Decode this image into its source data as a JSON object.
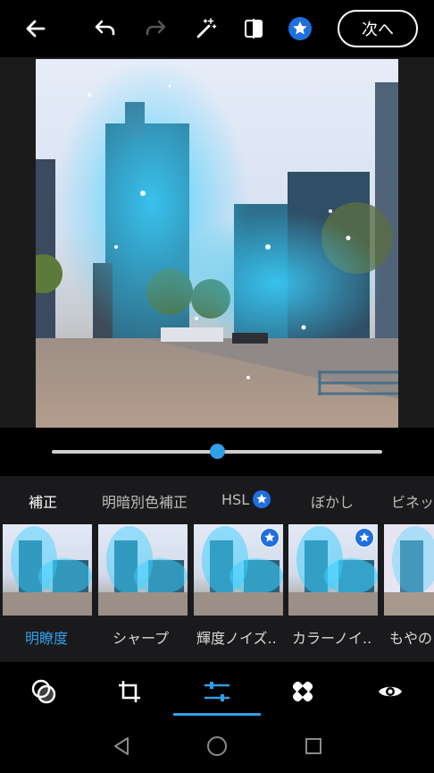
{
  "header": {
    "next_label": "次へ"
  },
  "icons": {
    "back": "back-arrow-icon",
    "undo": "undo-icon",
    "redo": "redo-icon",
    "auto_fix": "magic-wand-icon",
    "compare": "compare-icon",
    "premium": "star-badge-icon"
  },
  "slider": {
    "value_fraction": 0.5
  },
  "tabs": [
    {
      "label": "補正",
      "active": true
    },
    {
      "label": "明暗別色補正",
      "active": false
    },
    {
      "label": "HSL",
      "active": false,
      "premium": true
    },
    {
      "label": "ぼかし",
      "active": false
    },
    {
      "label": "ビネッ",
      "active": false
    }
  ],
  "presets": [
    {
      "label": "明瞭度",
      "active": true,
      "premium": false
    },
    {
      "label": "シャープ",
      "active": false,
      "premium": false
    },
    {
      "label": "輝度ノイズ..",
      "active": false,
      "premium": true
    },
    {
      "label": "カラーノイ..",
      "active": false,
      "premium": true
    },
    {
      "label": "もやの",
      "active": false,
      "premium": false
    }
  ],
  "tools": [
    {
      "name": "looks-icon",
      "active": false
    },
    {
      "name": "crop-icon",
      "active": false
    },
    {
      "name": "adjust-sliders-icon",
      "active": true
    },
    {
      "name": "healing-icon",
      "active": false
    },
    {
      "name": "eye-icon",
      "active": false
    }
  ],
  "colors": {
    "accent": "#2f9fe8",
    "premium": "#1f6fe0",
    "panel_bg": "#1a1a1c"
  }
}
